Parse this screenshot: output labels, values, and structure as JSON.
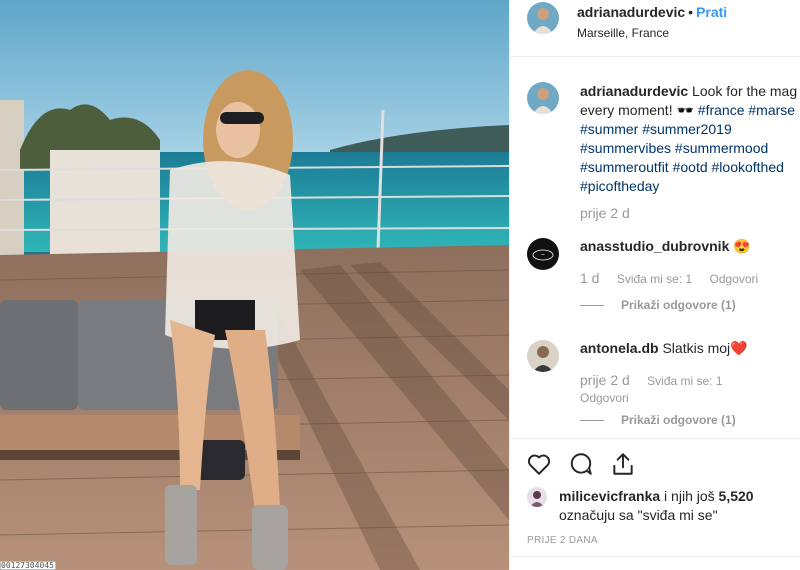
{
  "post": {
    "username": "adrianadurdevic",
    "separator": "•",
    "follow_label": "Prati",
    "location": "Marseille, France"
  },
  "caption": {
    "username": "adrianadurdevic",
    "text_start": "Look for the mag",
    "line2_text": "every moment! ",
    "line2_emoji": "🕶️",
    "line2_tags": " #france #marse",
    "line3": "#summer #summer2019",
    "line4": "#summervibes #summermood",
    "line5": "#summeroutfit #ootd #lookofthed",
    "line6": "#picoftheday",
    "time": "prije 2 d"
  },
  "comments": [
    {
      "username": "anasstudio_dubrovnik",
      "text": "😍",
      "time": "1 d",
      "likes_label": "Sviđa mi se: 1",
      "reply_label": "Odgovori",
      "show_replies": "Prikaži odgovore (1)"
    },
    {
      "username": "antonela.db",
      "text": "Slatkis moj❤️",
      "time": "prije 2 d",
      "likes_label": "Sviđa mi se: 1",
      "reply_label": "Odgovori",
      "show_replies": "Prikaži odgovore (1)"
    }
  ],
  "icons": [
    "heart-icon",
    "comment-icon",
    "share-icon"
  ],
  "likes": {
    "username": "milicevicfranka",
    "text_mid": " i njih još ",
    "count": "5,520",
    "text_end": "označuju sa \"sviđa mi se\""
  },
  "date": "PRIJE 2 DANA",
  "image_badge": "00127304045",
  "colors": {
    "link": "#3897f0",
    "hashtag": "#003569",
    "muted": "#999999",
    "text": "#262626"
  }
}
